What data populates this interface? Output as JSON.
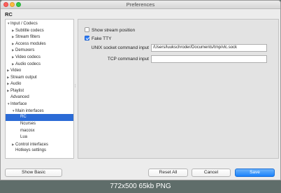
{
  "window": {
    "title": "Preferences"
  },
  "pane_title": "RC",
  "tree": [
    {
      "label": "Input / Codecs",
      "level": 0,
      "arrow": "▼",
      "selected": false
    },
    {
      "label": "Subtitle codecs",
      "level": 1,
      "arrow": "▶",
      "selected": false
    },
    {
      "label": "Stream filters",
      "level": 1,
      "arrow": "▶",
      "selected": false
    },
    {
      "label": "Access modules",
      "level": 1,
      "arrow": "▶",
      "selected": false
    },
    {
      "label": "Demuxers",
      "level": 1,
      "arrow": "▶",
      "selected": false
    },
    {
      "label": "Video codecs",
      "level": 1,
      "arrow": "▶",
      "selected": false
    },
    {
      "label": "Audio codecs",
      "level": 1,
      "arrow": "▶",
      "selected": false
    },
    {
      "label": "Video",
      "level": 0,
      "arrow": "▶",
      "selected": false
    },
    {
      "label": "Stream output",
      "level": 0,
      "arrow": "▶",
      "selected": false
    },
    {
      "label": "Audio",
      "level": 0,
      "arrow": "▶",
      "selected": false
    },
    {
      "label": "Playlist",
      "level": 0,
      "arrow": "▶",
      "selected": false
    },
    {
      "label": "Advanced",
      "level": 0,
      "arrow": "",
      "selected": false
    },
    {
      "label": "Interface",
      "level": 0,
      "arrow": "▼",
      "selected": false
    },
    {
      "label": "Main interfaces",
      "level": 1,
      "arrow": "▼",
      "selected": false
    },
    {
      "label": "RC",
      "level": 2,
      "arrow": "",
      "selected": true
    },
    {
      "label": "Ncurses",
      "level": 2,
      "arrow": "",
      "selected": false
    },
    {
      "label": "macosx",
      "level": 2,
      "arrow": "",
      "selected": false
    },
    {
      "label": "Lua",
      "level": 2,
      "arrow": "",
      "selected": false
    },
    {
      "label": "Control interfaces",
      "level": 1,
      "arrow": "▶",
      "selected": false
    },
    {
      "label": "Hotkeys settings",
      "level": 1,
      "arrow": "",
      "selected": false
    }
  ],
  "settings": {
    "show_stream_position": {
      "label": "Show stream position",
      "checked": false
    },
    "fake_tty": {
      "label": "Fake TTY",
      "checked": true
    },
    "unix_socket": {
      "label": "UNIX socket command input",
      "value": "/Users/luukschroder/Documents/tmp/vlc.sock"
    },
    "tcp_command": {
      "label": "TCP command input",
      "value": ""
    }
  },
  "buttons": {
    "show_basic": "Show Basic",
    "reset_all": "Reset All",
    "cancel": "Cancel",
    "save": "Save"
  },
  "caption": "772x500 65kb PNG",
  "colors": {
    "selection": "#2b6bd6",
    "primary_button": "#1a82fb"
  }
}
